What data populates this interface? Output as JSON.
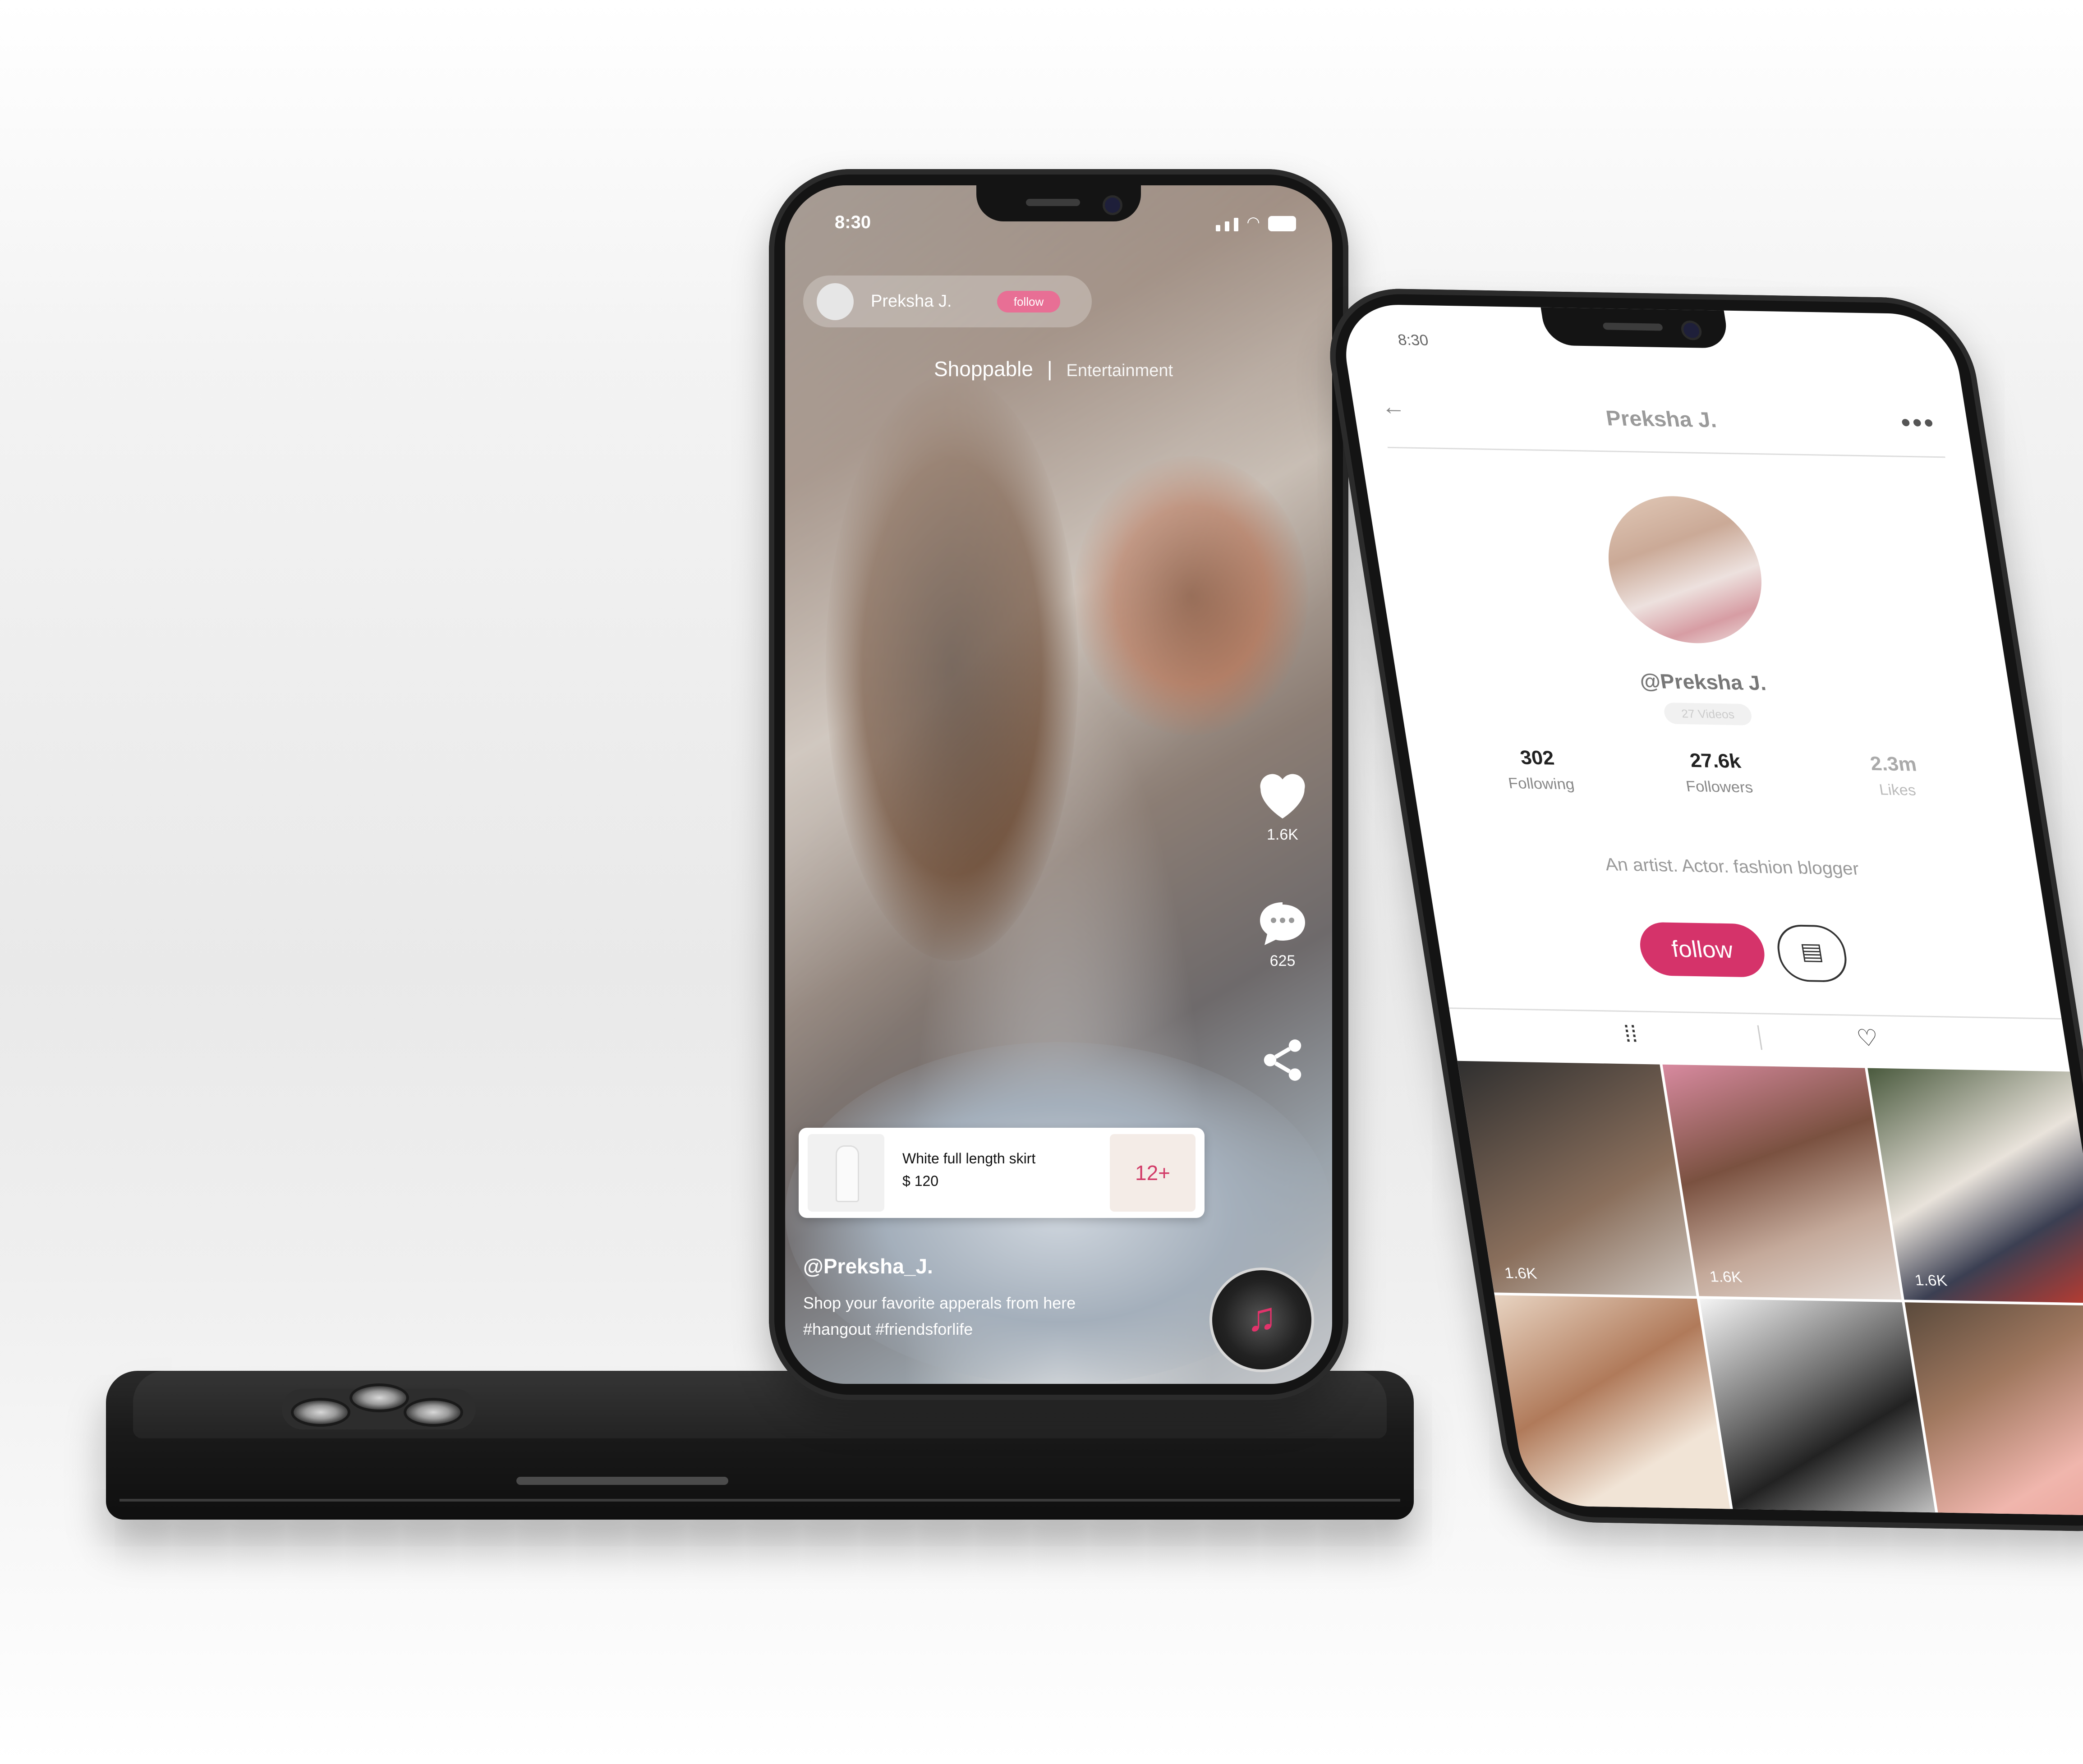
{
  "front": {
    "status_time": "8:30",
    "creator_name": "Preksha J.",
    "follow_chip": "follow",
    "tab_active": "Shoppable",
    "tab_divider": "|",
    "tab_inactive": "Entertainment",
    "likes_count": "1.6K",
    "comments_count": "625",
    "product": {
      "name": "White full length skirt",
      "price": "$ 120",
      "more": "12+"
    },
    "handle": "@Preksha_J.",
    "caption_line1": "Shop your favorite apperals from here",
    "caption_line2": "#hangout #friendsforlife",
    "icons": {
      "like": "heart-icon",
      "comment": "comment-bubble-icon",
      "share": "share-icon",
      "music": "music-note-icon"
    }
  },
  "profile": {
    "status_time": "8:30",
    "title": "Preksha J.",
    "more": "•••",
    "back": "←",
    "handle": "@Preksha J.",
    "videos_chip": "27 Videos",
    "stats": [
      {
        "value": "302",
        "label": "Following"
      },
      {
        "value": "27.6k",
        "label": "Followers"
      },
      {
        "value": "2.3m",
        "label": "Likes"
      }
    ],
    "bio": "An artist. Actor. fashion blogger",
    "follow_button": "follow",
    "message_icon": "message-icon",
    "tabs": {
      "grid_icon": "grid-icon",
      "liked_icon": "heart-outline-icon"
    },
    "tile_likes": [
      "1.6K",
      "1.6K",
      "1.6K"
    ]
  },
  "colors": {
    "accent_pink": "#d5336a",
    "chip_pink": "#e86f95",
    "phone_body": "#141414"
  }
}
